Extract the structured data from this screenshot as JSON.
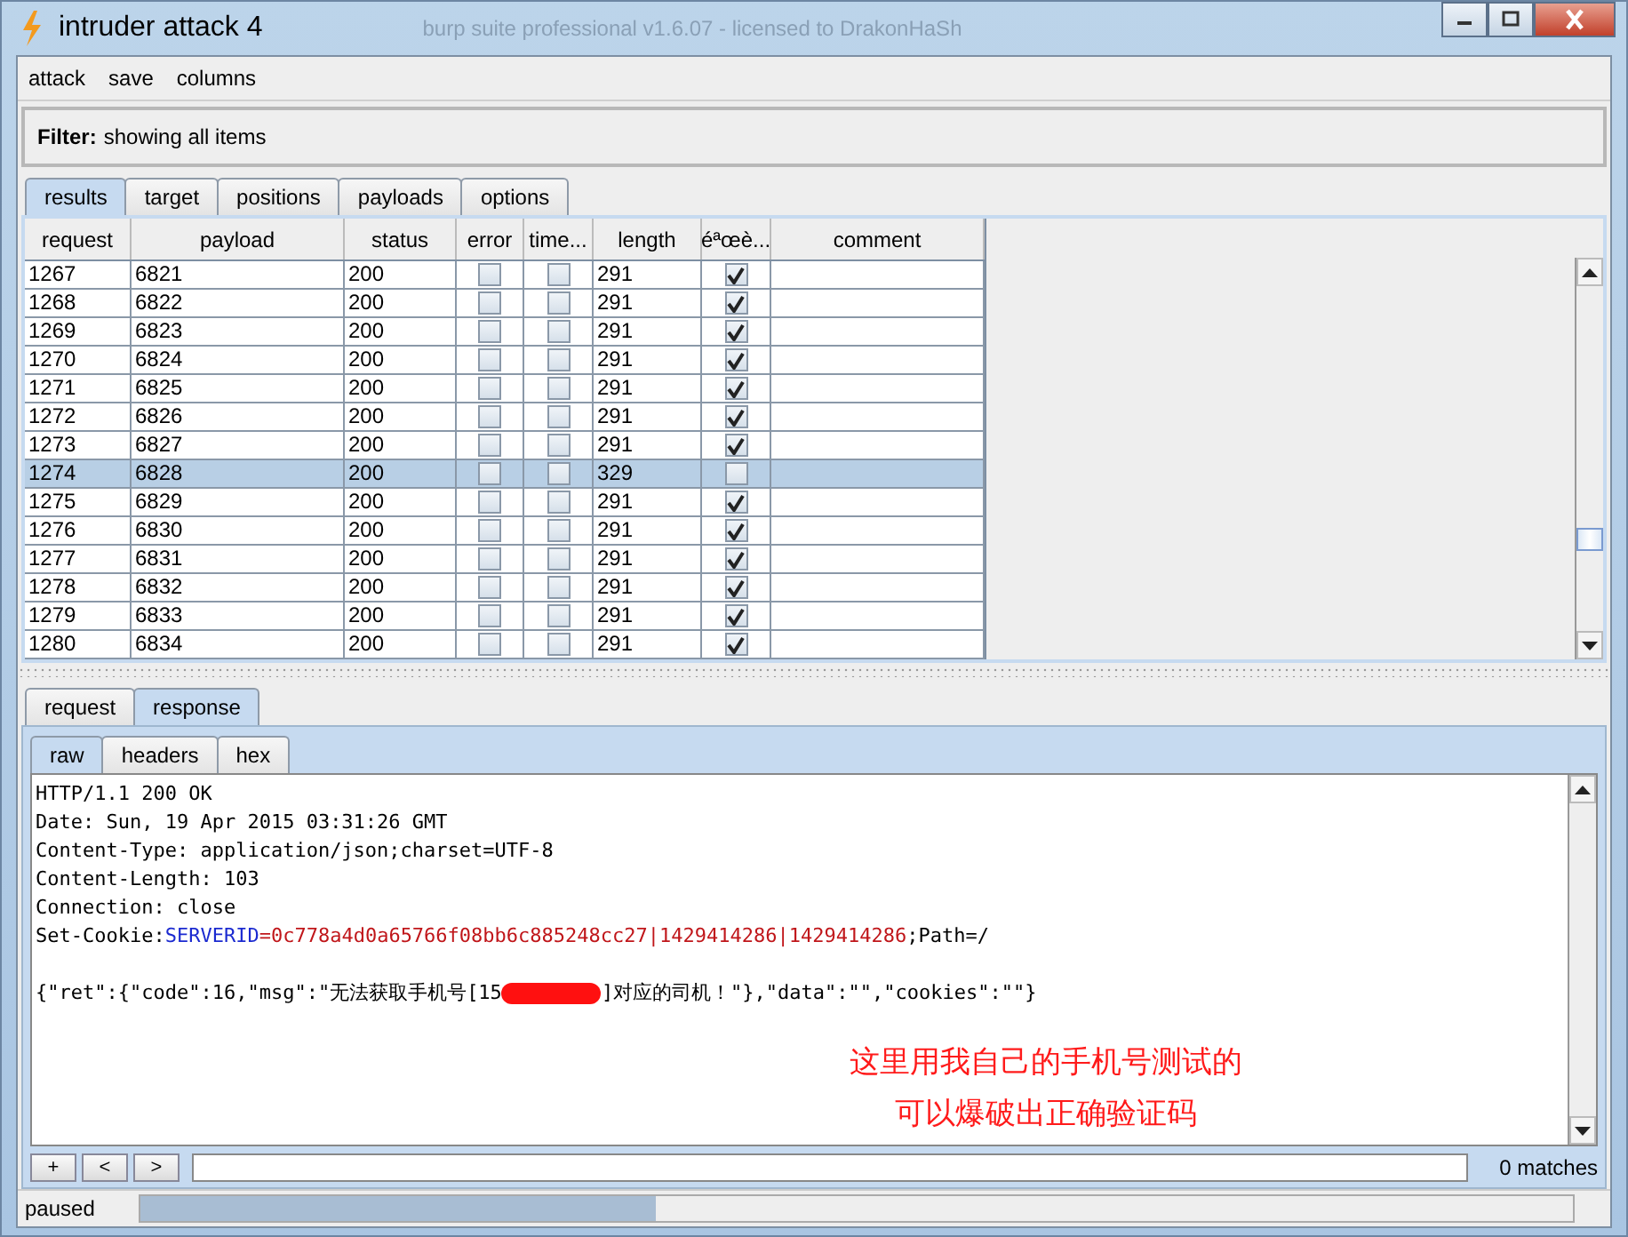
{
  "window": {
    "title": "intruder attack 4",
    "background_title": "burp suite professional v1.6.07 - licensed to DrakonHaSh"
  },
  "menu": [
    "attack",
    "save",
    "columns"
  ],
  "filter": {
    "label": "Filter:",
    "value": "showing all items"
  },
  "tabs": [
    {
      "label": "results",
      "selected": true
    },
    {
      "label": "target",
      "selected": false
    },
    {
      "label": "positions",
      "selected": false
    },
    {
      "label": "payloads",
      "selected": false
    },
    {
      "label": "options",
      "selected": false
    }
  ],
  "table": {
    "columns": [
      "request",
      "payload",
      "status",
      "error",
      "time...",
      "length",
      "éªœè...",
      "comment"
    ],
    "rows": [
      {
        "request": "1267",
        "payload": "6821",
        "status": "200",
        "error": false,
        "timeout": false,
        "length": "291",
        "flag": true,
        "selected": false
      },
      {
        "request": "1268",
        "payload": "6822",
        "status": "200",
        "error": false,
        "timeout": false,
        "length": "291",
        "flag": true,
        "selected": false
      },
      {
        "request": "1269",
        "payload": "6823",
        "status": "200",
        "error": false,
        "timeout": false,
        "length": "291",
        "flag": true,
        "selected": false
      },
      {
        "request": "1270",
        "payload": "6824",
        "status": "200",
        "error": false,
        "timeout": false,
        "length": "291",
        "flag": true,
        "selected": false
      },
      {
        "request": "1271",
        "payload": "6825",
        "status": "200",
        "error": false,
        "timeout": false,
        "length": "291",
        "flag": true,
        "selected": false
      },
      {
        "request": "1272",
        "payload": "6826",
        "status": "200",
        "error": false,
        "timeout": false,
        "length": "291",
        "flag": true,
        "selected": false
      },
      {
        "request": "1273",
        "payload": "6827",
        "status": "200",
        "error": false,
        "timeout": false,
        "length": "291",
        "flag": true,
        "selected": false
      },
      {
        "request": "1274",
        "payload": "6828",
        "status": "200",
        "error": false,
        "timeout": false,
        "length": "329",
        "flag": false,
        "selected": true
      },
      {
        "request": "1275",
        "payload": "6829",
        "status": "200",
        "error": false,
        "timeout": false,
        "length": "291",
        "flag": true,
        "selected": false
      },
      {
        "request": "1276",
        "payload": "6830",
        "status": "200",
        "error": false,
        "timeout": false,
        "length": "291",
        "flag": true,
        "selected": false
      },
      {
        "request": "1277",
        "payload": "6831",
        "status": "200",
        "error": false,
        "timeout": false,
        "length": "291",
        "flag": true,
        "selected": false
      },
      {
        "request": "1278",
        "payload": "6832",
        "status": "200",
        "error": false,
        "timeout": false,
        "length": "291",
        "flag": true,
        "selected": false
      },
      {
        "request": "1279",
        "payload": "6833",
        "status": "200",
        "error": false,
        "timeout": false,
        "length": "291",
        "flag": true,
        "selected": false
      },
      {
        "request": "1280",
        "payload": "6834",
        "status": "200",
        "error": false,
        "timeout": false,
        "length": "291",
        "flag": true,
        "selected": false
      }
    ]
  },
  "detail_tabs": [
    {
      "label": "request",
      "selected": false
    },
    {
      "label": "response",
      "selected": true
    }
  ],
  "view_tabs": [
    {
      "label": "raw",
      "selected": true
    },
    {
      "label": "headers",
      "selected": false
    },
    {
      "label": "hex",
      "selected": false
    }
  ],
  "response": {
    "headers": [
      "HTTP/1.1 200 OK",
      "Date: Sun, 19 Apr 2015 03:31:26 GMT",
      "Content-Type: application/json;charset=UTF-8",
      "Content-Length: 103",
      "Connection: close"
    ],
    "cookie": {
      "name": "Set-Cookie: ",
      "key": "SERVERID",
      "value": "=0c778a4d0a65766f08bb6c885248cc27|1429414286|1429414286",
      "rest": ";Path=/"
    },
    "body_before": "{\"ret\":{\"code\":16,\"msg\":\"无法获取手机号[15",
    "body_after": "]对应的司机！\"},\"data\":\"\",\"cookies\":\"\"}",
    "annotation": [
      "这里用我自己的手机号测试的",
      "可以爆破出正确验证码"
    ]
  },
  "search": {
    "buttons": [
      "+",
      "<",
      ">"
    ],
    "matches": "0 matches"
  },
  "status_bar": {
    "text": "paused",
    "level": 0.36
  }
}
